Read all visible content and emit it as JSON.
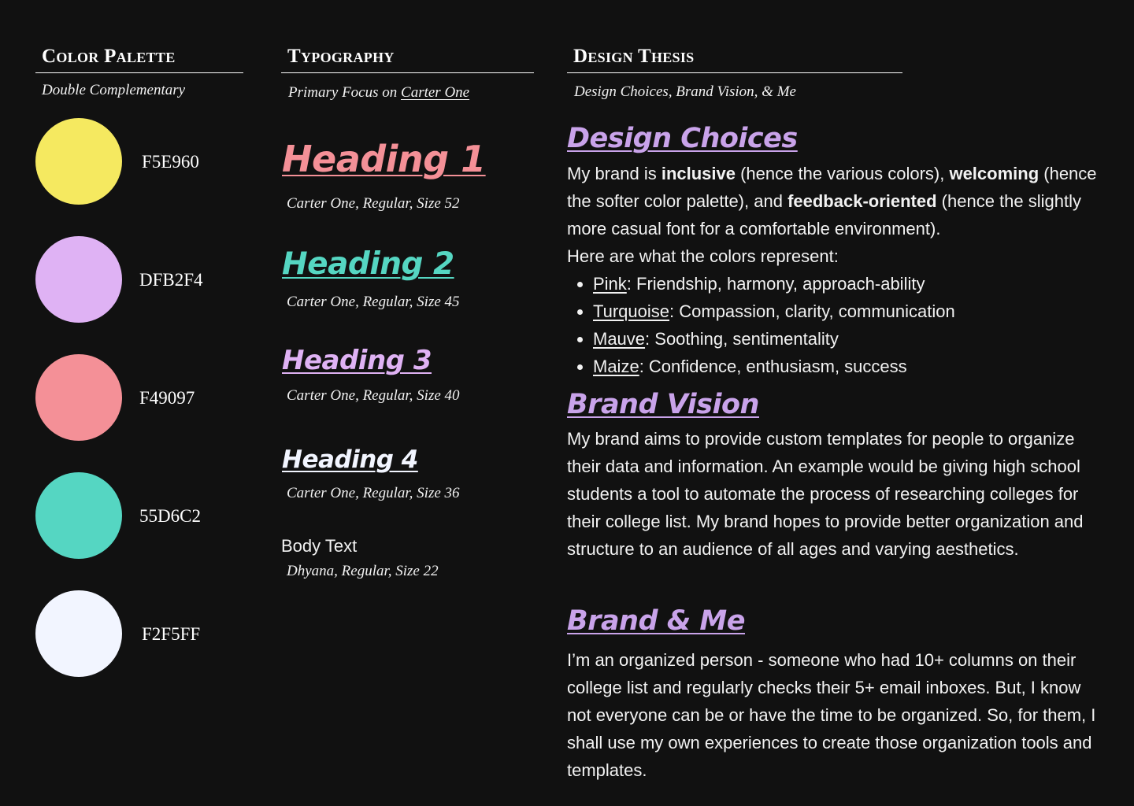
{
  "palette": {
    "heading": "Color Palette",
    "subtitle": "Double Complementary",
    "swatches": [
      {
        "hex": "F5E960",
        "color": "#F5E960"
      },
      {
        "hex": "DFB2F4",
        "color": "#DFB2F4"
      },
      {
        "hex": "F49097",
        "color": "#F49097"
      },
      {
        "hex": "55D6C2",
        "color": "#55D6C2"
      },
      {
        "hex": "F2F5FF",
        "color": "#F2F5FF"
      }
    ]
  },
  "typography": {
    "heading": "Typography",
    "subtitle_prefix": "Primary Focus on ",
    "subtitle_font": "Carter One",
    "samples": [
      {
        "label": "Heading 1",
        "spec": "Carter One, Regular, Size 52",
        "color": "#F49097"
      },
      {
        "label": "Heading 2",
        "spec": "Carter One, Regular, Size 45",
        "color": "#55D6C2"
      },
      {
        "label": "Heading 3",
        "spec": "Carter One, Regular, Size 40",
        "color": "#DFB2F4"
      },
      {
        "label": "Heading 4",
        "spec": "Carter One, Regular, Size 36",
        "color": "#F2F5FF"
      }
    ],
    "body": {
      "label": "Body Text",
      "spec": "Dhyana, Regular, Size 22"
    }
  },
  "thesis": {
    "heading": "Design Thesis",
    "subtitle": "Design Choices, Brand Vision, & Me",
    "design_choices": {
      "title": "Design Choices",
      "t1": "My brand is ",
      "b1": "inclusive",
      "t2": " (hence the various colors), ",
      "b2": "welcoming",
      "t3": " (hence the softer color palette), and ",
      "b3": "feedback-oriented",
      "t4": " (hence the slightly more casual font for a comfortable environment).",
      "intro": "Here are what the colors represent:",
      "items": [
        {
          "key": "Pink",
          "desc": ": Friendship, harmony, approach-ability"
        },
        {
          "key": "Turquoise",
          "desc": ": Compassion, clarity, communication"
        },
        {
          "key": "Mauve",
          "desc": ": Soothing, sentimentality"
        },
        {
          "key": "Maize",
          "desc": ": Confidence, enthusiasm, success"
        }
      ]
    },
    "brand_vision": {
      "title": "Brand Vision",
      "text": "My brand aims to provide custom templates for people to organize their data and information. An example would be giving high school students a tool to automate the process of researching colleges for their college list. My brand hopes to provide better organization and structure to an audience of all ages and varying aesthetics."
    },
    "brand_me": {
      "title": "Brand & Me",
      "text": "I’m an organized person - someone who had 10+ columns on their college list and regularly checks their 5+ email inboxes. But, I know not everyone can be or have the time to be organized. So, for them, I shall use my own experiences to create those organization tools and templates."
    }
  }
}
